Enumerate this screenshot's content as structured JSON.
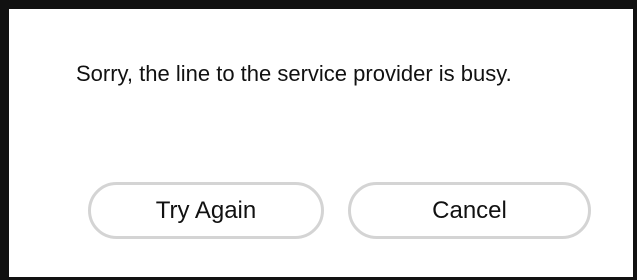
{
  "dialog": {
    "message": "Sorry, the line to the service provider is busy.",
    "try_again_label": "Try Again",
    "cancel_label": "Cancel"
  }
}
